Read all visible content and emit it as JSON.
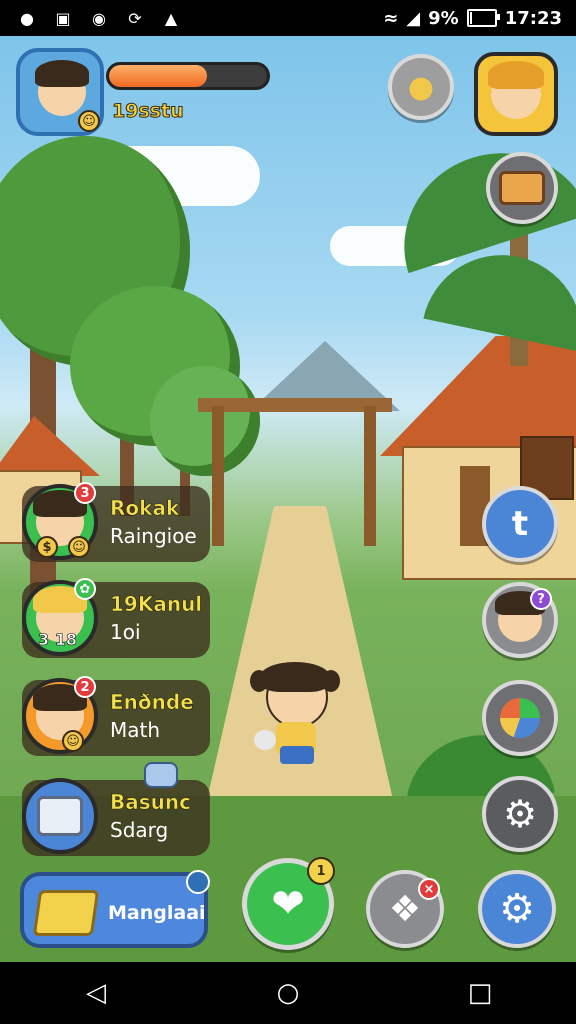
{
  "status_bar": {
    "battery": "9%",
    "time": "17:23",
    "battery_level": 0.09,
    "icons": [
      "location-icon",
      "image-icon",
      "camera-icon",
      "sync-icon",
      "notification-icon",
      "wifi-icon",
      "signal-icon",
      "battery-icon"
    ]
  },
  "player": {
    "name": "19sstu",
    "xp_fraction": 0.62
  },
  "friends": [
    {
      "name": "Rokak",
      "sub": "Raingioe",
      "badge": "3",
      "badge_color": "#e23b3b",
      "theme": "#3bbf4f"
    },
    {
      "name": "19Kanul",
      "sub": "1oi",
      "badge": "",
      "badge_color": "#3bbf4f",
      "theme": "#3bbf4f",
      "extra": "3 18"
    },
    {
      "name": "Enðnde",
      "sub": "Math",
      "badge": "2",
      "badge_color": "#e23b3b",
      "theme": "#f39a2b"
    },
    {
      "name": "Basunc",
      "sub": "Sdarg",
      "badge": "",
      "badge_color": "#4b86d6",
      "theme": "#4b86d6"
    }
  ],
  "bottom": {
    "main_label": "Manglaai",
    "chat_badge": "1"
  },
  "colors": {
    "accent_orange": "#f06a22",
    "name_yellow": "#f6d43a",
    "button_blue": "#4b86d6",
    "button_green": "#3bbf4f"
  }
}
